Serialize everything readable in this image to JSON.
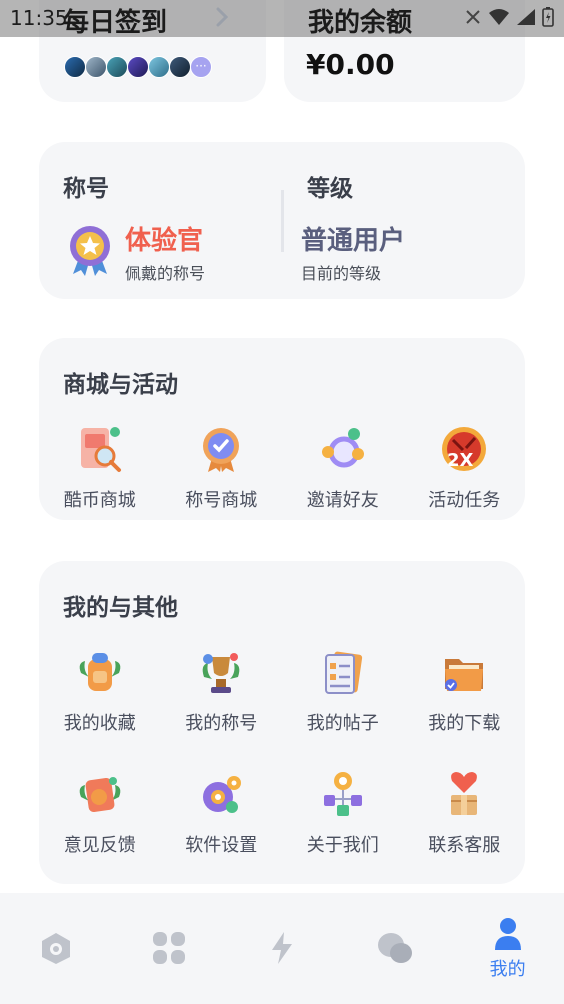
{
  "status_bar": {
    "time": "11:35"
  },
  "checkin": {
    "title": "每日签到",
    "more_label": "···"
  },
  "balance": {
    "title": "我的余额",
    "amount": "¥0.00"
  },
  "profile": {
    "title_label": "称号",
    "title_value": "体验官",
    "title_sub": "佩戴的称号",
    "level_label": "等级",
    "level_value": "普通用户",
    "level_sub": "目前的等级"
  },
  "shop_section": {
    "heading": "商城与活动",
    "items": [
      {
        "label": "酷币商城",
        "icon": "coin-shop-icon"
      },
      {
        "label": "称号商城",
        "icon": "badge-shop-icon"
      },
      {
        "label": "邀请好友",
        "icon": "invite-friends-icon"
      },
      {
        "label": "活动任务",
        "icon": "activity-task-icon"
      }
    ]
  },
  "other_section": {
    "heading": "我的与其他",
    "items": [
      {
        "label": "我的收藏",
        "icon": "favorites-icon"
      },
      {
        "label": "我的称号",
        "icon": "my-titles-icon"
      },
      {
        "label": "我的帖子",
        "icon": "my-posts-icon"
      },
      {
        "label": "我的下载",
        "icon": "downloads-icon"
      },
      {
        "label": "意见反馈",
        "icon": "feedback-icon"
      },
      {
        "label": "软件设置",
        "icon": "settings-icon"
      },
      {
        "label": "关于我们",
        "icon": "about-us-icon"
      },
      {
        "label": "联系客服",
        "icon": "customer-service-icon"
      }
    ]
  },
  "bottom_nav": {
    "items": [
      {
        "icon": "home-pin-icon",
        "label": ""
      },
      {
        "icon": "apps-grid-icon",
        "label": ""
      },
      {
        "icon": "lightning-icon",
        "label": ""
      },
      {
        "icon": "chat-bubbles-icon",
        "label": ""
      },
      {
        "icon": "user-icon",
        "label": "我的",
        "active": true
      }
    ]
  },
  "colors": {
    "accent": "#3b7ef0",
    "title_value": "#f0604e",
    "level_value": "#5a5f7e",
    "card_bg": "#f5f6f8"
  }
}
